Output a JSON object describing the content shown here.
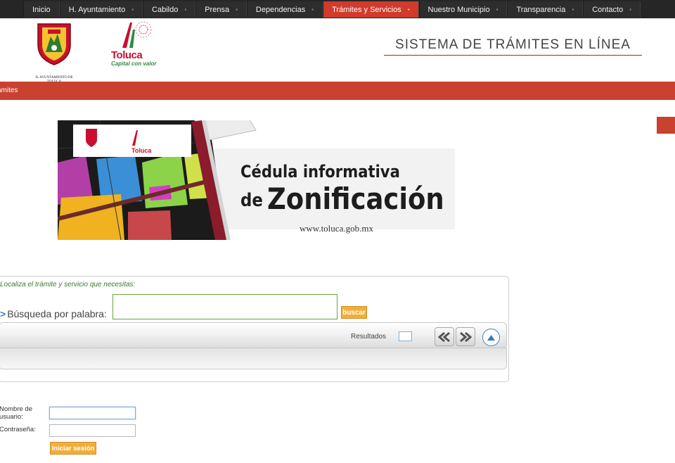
{
  "nav": {
    "items": [
      {
        "label": "Inicio",
        "caret": ""
      },
      {
        "label": "H. Ayuntamiento",
        "caret": "▪"
      },
      {
        "label": "Cabildo",
        "caret": "▪"
      },
      {
        "label": "Prensa",
        "caret": "▪"
      },
      {
        "label": "Dependencias",
        "caret": "▪"
      },
      {
        "label": "Trámites y Servicios",
        "caret": "▪"
      },
      {
        "label": "Nuestro Municipio",
        "caret": "▪"
      },
      {
        "label": "Transparencia",
        "caret": "▪"
      },
      {
        "label": "Contacto",
        "caret": "▪"
      }
    ],
    "active_label": "Trámites y Servicios"
  },
  "header": {
    "system_title": "SISTEMA DE TRÁMITES EN LÍNEA",
    "ayuntamiento_caption": "H. AYUNTAMIENTO DE TOLUCA",
    "toluca_logo_text": "Toluca",
    "toluca_slogan": "Capital con valor"
  },
  "breadcrumb_bar": {
    "text": "ámites"
  },
  "banner": {
    "title_line1": "Cédula informativa",
    "title_de": "de",
    "title_line2": "Zonificación",
    "url": "www.toluca.gob.mx"
  },
  "search": {
    "hint": "Localiza el trámite y servicio que necesitas:",
    "label": "Búsqueda por palabra:",
    "arrow": ">",
    "input_value": "",
    "button_label": "buscar",
    "results_label": "Resultados",
    "results_count": ""
  },
  "login": {
    "user_label": "Nombre de usuario:",
    "pass_label": "Contraseña:",
    "user_value": "",
    "pass_value": "",
    "button_label": "Iniciar sesión"
  },
  "colors": {
    "nav_background": "#262626",
    "nav_active": "#d23a2c",
    "red_bar": "#c9412f",
    "button_orange": "#f2ae3a",
    "hint_green": "#3a7d2a",
    "pager_blue": "#4a86c5"
  },
  "icons": {
    "pager_prev": "double-chevron-left-icon",
    "pager_next": "double-chevron-right-icon",
    "collapse": "chevron-up-circle-icon",
    "search_arrow": "arrow-right-icon"
  }
}
